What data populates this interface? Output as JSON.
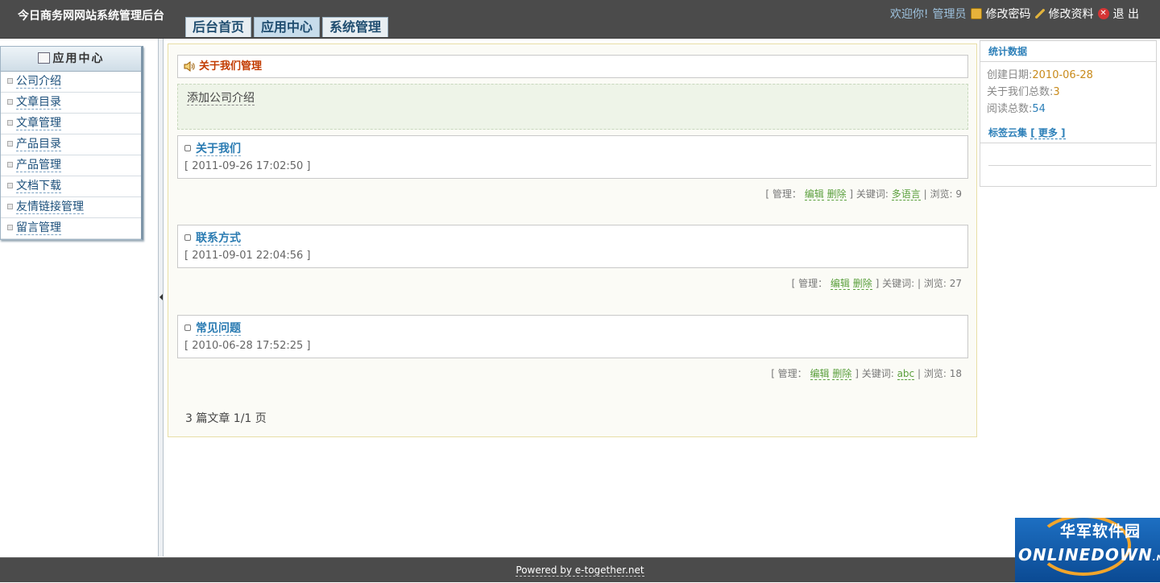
{
  "header": {
    "site_title": "今日商务网网站系统管理后台",
    "tabs": [
      {
        "label": "后台首页",
        "active": false
      },
      {
        "label": "应用中心",
        "active": true
      },
      {
        "label": "系统管理",
        "active": false
      }
    ],
    "user": {
      "welcome": "欢迎你!",
      "name": "管理员",
      "change_password": "修改密码",
      "edit_profile": "修改资料",
      "logout": "退 出"
    }
  },
  "sidebar": {
    "title": "应用中心",
    "items": [
      {
        "label": "公司介绍"
      },
      {
        "label": "文章目录"
      },
      {
        "label": "文章管理"
      },
      {
        "label": "产品目录"
      },
      {
        "label": "产品管理"
      },
      {
        "label": "文档下载"
      },
      {
        "label": "友情链接管理"
      },
      {
        "label": "留言管理"
      }
    ]
  },
  "main": {
    "panel_title": "关于我们管理",
    "add_link": "添加公司介绍",
    "manage_label": "[ 管理：",
    "edit_label": "编辑",
    "delete_label": "删除",
    "keyword_label": "] 关键词:",
    "views_label": "| 浏览:",
    "articles": [
      {
        "title": "关于我们",
        "date": "[ 2011-09-26 17:02:50 ]",
        "keyword": "多语言",
        "views": "9"
      },
      {
        "title": "联系方式",
        "date": "[ 2011-09-01 22:04:56 ]",
        "keyword": "",
        "views": "27"
      },
      {
        "title": "常见问题",
        "date": "[ 2010-06-28 17:52:25 ]",
        "keyword": "abc",
        "views": "18"
      }
    ],
    "pager": "3 篇文章  1/1 页"
  },
  "stats": {
    "title": "统计数据",
    "created_label": "创建日期:",
    "created_value": "2010-06-28",
    "total_label": "关于我们总数:",
    "total_value": "3",
    "reads_label": "阅读总数:",
    "reads_value": "54",
    "tags_title": "标签云集",
    "tags_more": "[ 更多 ]"
  },
  "footer": {
    "powered": "Powered by e-together.net"
  },
  "watermark": {
    "cn": "华军软件园",
    "en": "ONLINEDOWN",
    "en_suffix": ".NET"
  },
  "colors": {
    "topbar": "#4b4b4b",
    "link_blue": "#2c7fb8",
    "link_green": "#5a9f3c",
    "title_red": "#c23b00"
  }
}
